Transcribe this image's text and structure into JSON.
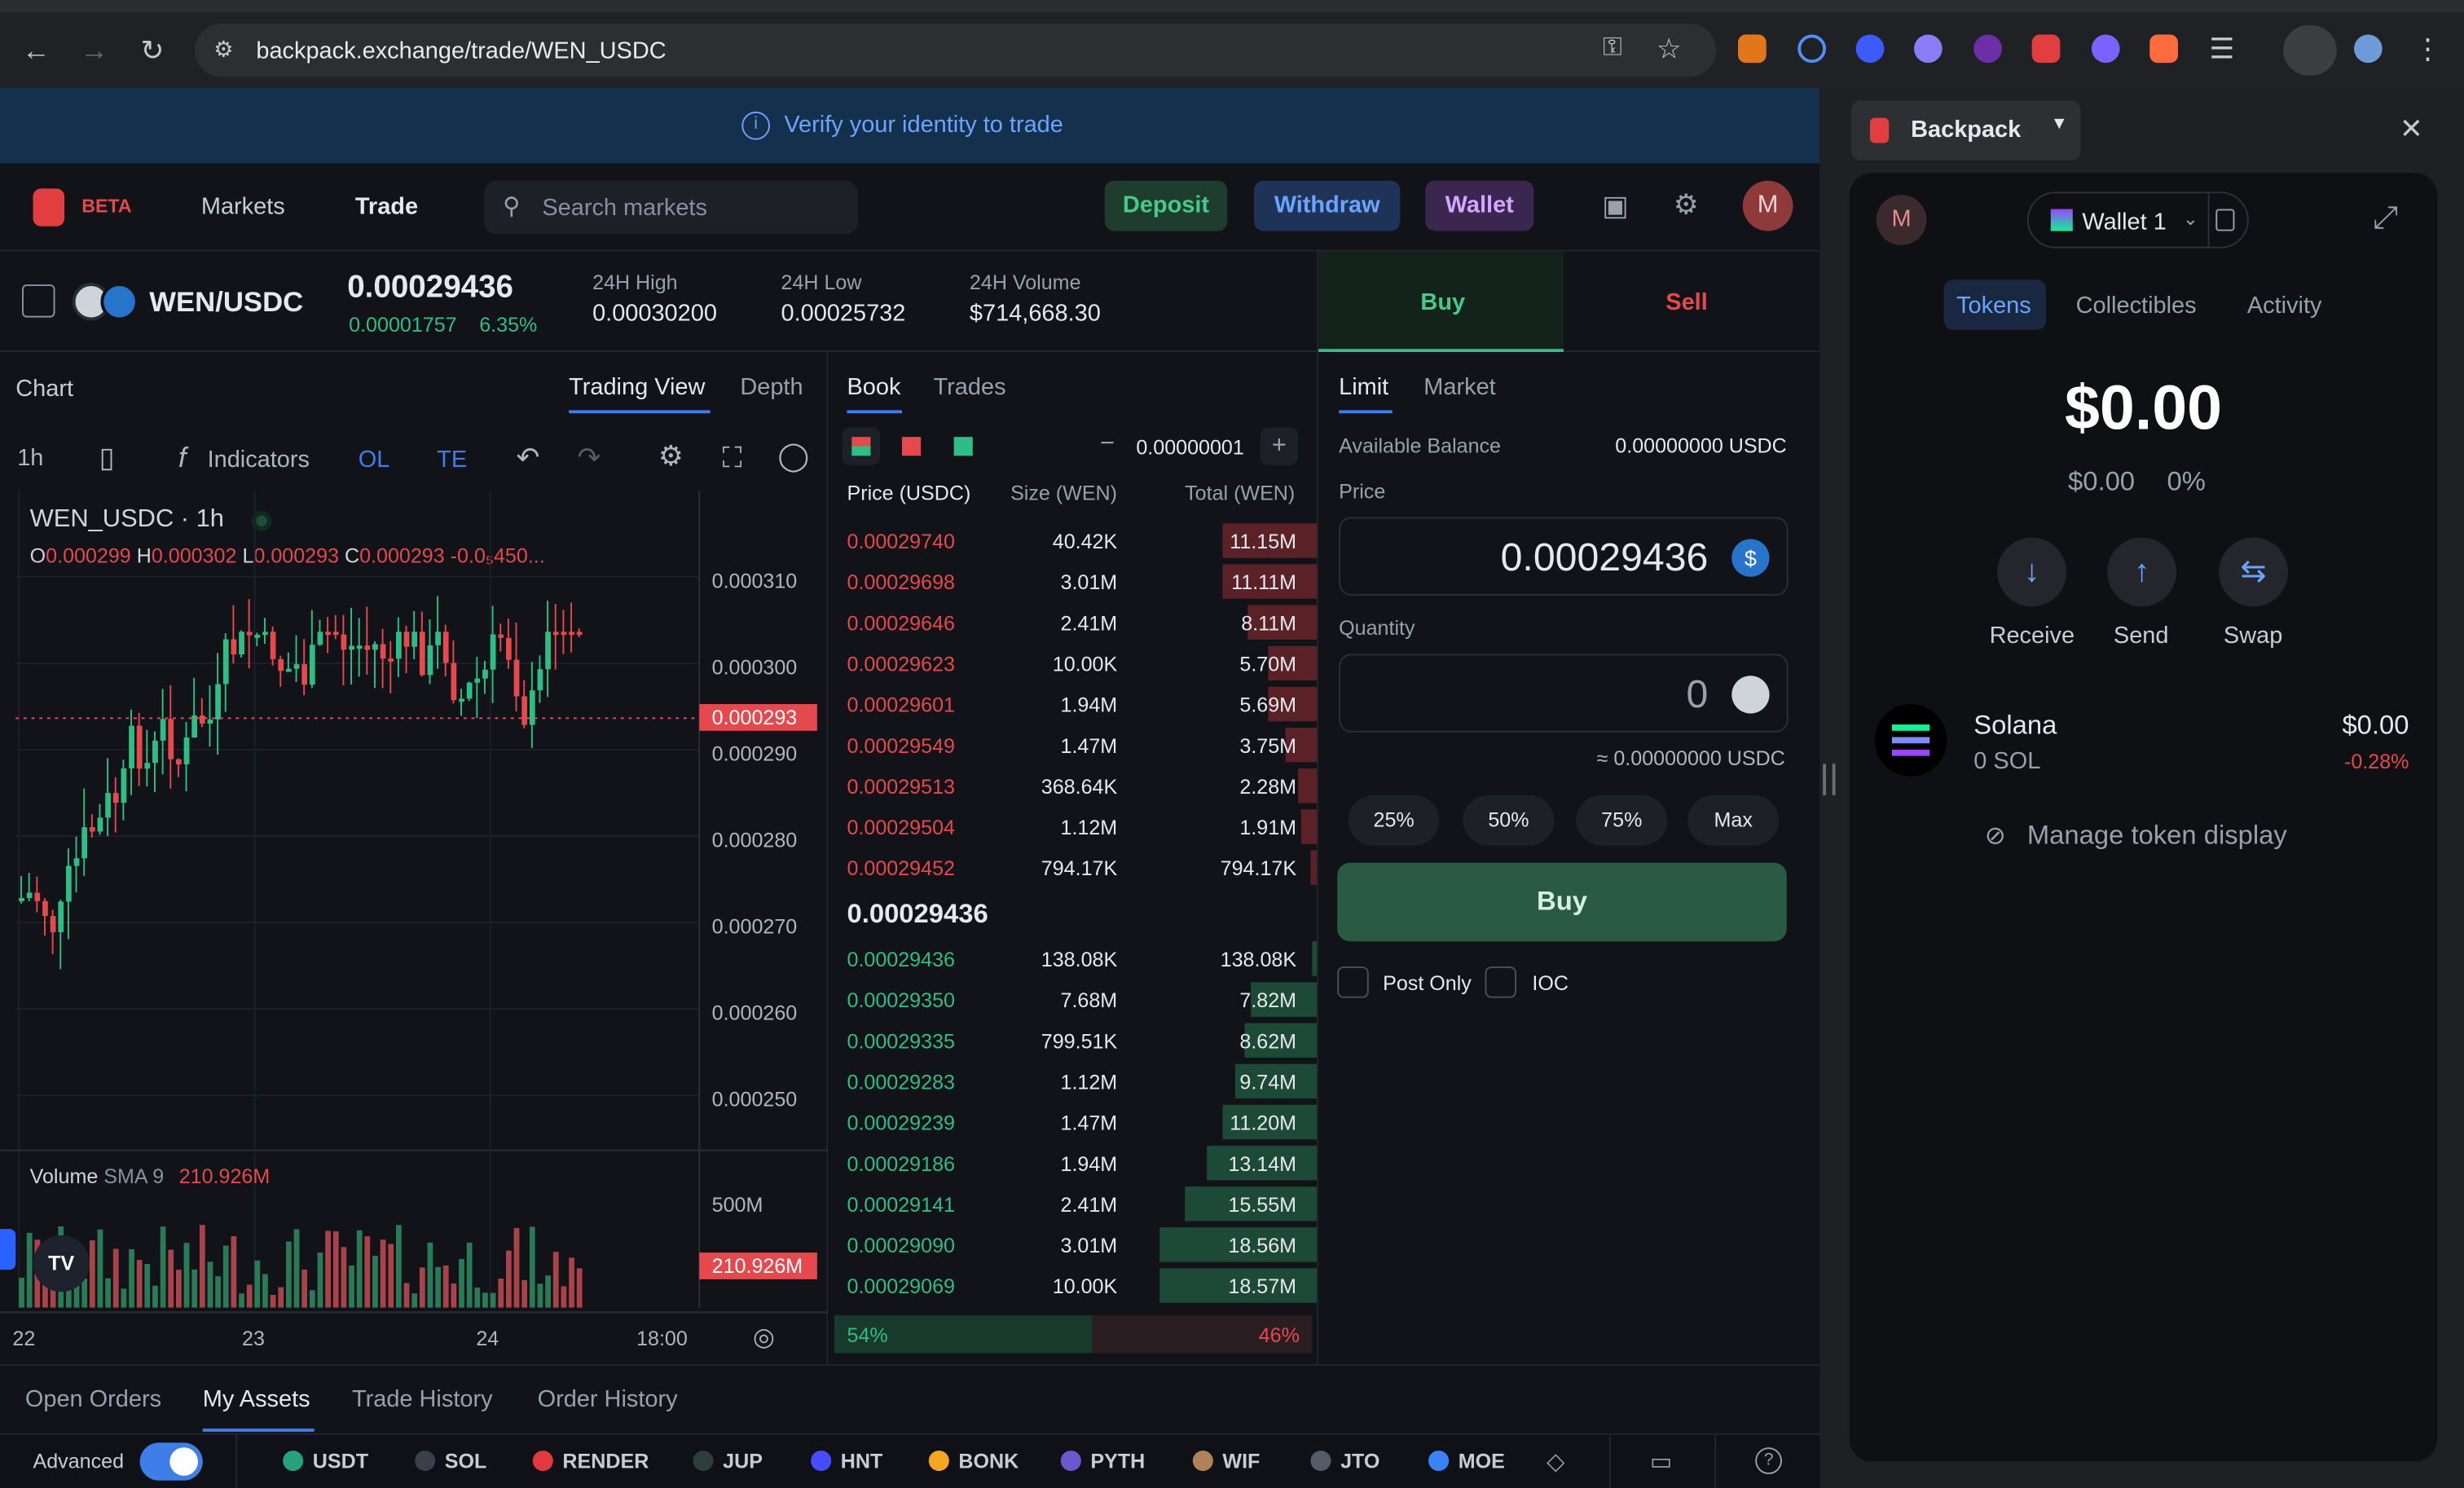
{
  "browser": {
    "url": "backpack.exchange/trade/WEN_USDC"
  },
  "banner": {
    "text": "Verify your identity to trade"
  },
  "header": {
    "beta": "BETA",
    "nav_markets": "Markets",
    "nav_trade": "Trade",
    "search_placeholder": "Search markets",
    "deposit": "Deposit",
    "withdraw": "Withdraw",
    "wallet": "Wallet",
    "avatar": "M"
  },
  "ticker": {
    "pair": "WEN/USDC",
    "price": "0.00029436",
    "change": "0.00001757",
    "change_pct": "6.35%",
    "high_label": "24H High",
    "high": "0.00030200",
    "low_label": "24H Low",
    "low": "0.00025732",
    "volume_label": "24H Volume",
    "volume": "$714,668.30"
  },
  "chart": {
    "title": "Chart",
    "tab_tradingview": "Trading View",
    "tab_depth": "Depth",
    "interval": "1h",
    "indicators": "Indicators",
    "ol": "OL",
    "te": "TE",
    "symbol": "WEN_USDC · 1h",
    "ohlc": {
      "o_label": "O",
      "o": "0.000299",
      "h_label": "H",
      "h": "0.000302",
      "l_label": "L",
      "l": "0.000293",
      "c_label": "C",
      "c": "0.000293",
      "chg": "-0.0₅450..."
    },
    "price_axis": [
      "0.000310",
      "0.000300",
      "0.000290",
      "0.000280",
      "0.000270",
      "0.000260",
      "0.000250"
    ],
    "last_price_tag": "0.000293",
    "volume_label": "Volume",
    "sma_label": "SMA 9",
    "sma_value": "210.926M",
    "vol_axis_500": "500M",
    "vol_tag": "210.926M",
    "time_axis": [
      "22",
      "23",
      "24",
      "18:00"
    ],
    "tv_logo": "TV"
  },
  "book": {
    "tab_book": "Book",
    "tab_trades": "Trades",
    "tick_size": "0.00000001",
    "col_price": "Price (USDC)",
    "col_size": "Size (WEN)",
    "col_total": "Total (WEN)",
    "asks": [
      {
        "price": "0.00029740",
        "size": "40.42K",
        "total": "11.15M",
        "depth": 0.6
      },
      {
        "price": "0.00029698",
        "size": "3.01M",
        "total": "11.11M",
        "depth": 0.6
      },
      {
        "price": "0.00029646",
        "size": "2.41M",
        "total": "8.11M",
        "depth": 0.44
      },
      {
        "price": "0.00029623",
        "size": "10.00K",
        "total": "5.70M",
        "depth": 0.31
      },
      {
        "price": "0.00029601",
        "size": "1.94M",
        "total": "5.69M",
        "depth": 0.31
      },
      {
        "price": "0.00029549",
        "size": "1.47M",
        "total": "3.75M",
        "depth": 0.2
      },
      {
        "price": "0.00029513",
        "size": "368.64K",
        "total": "2.28M",
        "depth": 0.12
      },
      {
        "price": "0.00029504",
        "size": "1.12M",
        "total": "1.91M",
        "depth": 0.1
      },
      {
        "price": "0.00029452",
        "size": "794.17K",
        "total": "794.17K",
        "depth": 0.04
      }
    ],
    "mid_price": "0.00029436",
    "bids": [
      {
        "price": "0.00029436",
        "size": "138.08K",
        "total": "138.08K",
        "depth": 0.03
      },
      {
        "price": "0.00029350",
        "size": "7.68M",
        "total": "7.82M",
        "depth": 0.42
      },
      {
        "price": "0.00029335",
        "size": "799.51K",
        "total": "8.62M",
        "depth": 0.46
      },
      {
        "price": "0.00029283",
        "size": "1.12M",
        "total": "9.74M",
        "depth": 0.52
      },
      {
        "price": "0.00029239",
        "size": "1.47M",
        "total": "11.20M",
        "depth": 0.6
      },
      {
        "price": "0.00029186",
        "size": "1.94M",
        "total": "13.14M",
        "depth": 0.7
      },
      {
        "price": "0.00029141",
        "size": "2.41M",
        "total": "15.55M",
        "depth": 0.84
      },
      {
        "price": "0.00029090",
        "size": "3.01M",
        "total": "18.56M",
        "depth": 1.0
      },
      {
        "price": "0.00029069",
        "size": "10.00K",
        "total": "18.57M",
        "depth": 1.0
      }
    ],
    "buy_pct": "54%",
    "sell_pct": "46%",
    "buy_ratio": 0.54
  },
  "order": {
    "buy": "Buy",
    "sell": "Sell",
    "limit": "Limit",
    "market": "Market",
    "avail_label": "Available Balance",
    "avail": "0.00000000 USDC",
    "price_label": "Price",
    "price": "0.00029436",
    "qty_label": "Quantity",
    "qty": "0",
    "approx": "≈ 0.00000000 USDC",
    "p25": "25%",
    "p50": "50%",
    "p75": "75%",
    "max": "Max",
    "submit": "Buy",
    "post_only": "Post Only",
    "ioc": "IOC"
  },
  "bottom": {
    "tabs": [
      "Open Orders",
      "My Assets",
      "Trade History",
      "Order History"
    ],
    "advanced": "Advanced",
    "tokens": [
      {
        "sym": "USDT",
        "color": "#26a17b"
      },
      {
        "sym": "SOL",
        "color": "#3a3f4a"
      },
      {
        "sym": "RENDER",
        "color": "#e2383f"
      },
      {
        "sym": "JUP",
        "color": "#2c3e3a"
      },
      {
        "sym": "HNT",
        "color": "#474dff"
      },
      {
        "sym": "BONK",
        "color": "#f5a623"
      },
      {
        "sym": "PYTH",
        "color": "#6e56cf"
      },
      {
        "sym": "WIF",
        "color": "#b0825a"
      },
      {
        "sym": "JTO",
        "color": "#555b66"
      },
      {
        "sym": "MOE",
        "color": "#3b82f6"
      }
    ]
  },
  "wallet": {
    "title": "Backpack",
    "avatar": "M",
    "wallet_name": "Wallet 1",
    "tab_tokens": "Tokens",
    "tab_collectibles": "Collectibles",
    "tab_activity": "Activity",
    "balance": "$0.00",
    "balance_change": "$0.00",
    "balance_pct": "0%",
    "receive": "Receive",
    "send": "Send",
    "swap": "Swap",
    "token_name": "Solana",
    "token_amount": "0 SOL",
    "token_value": "$0.00",
    "token_change": "-0.28%",
    "manage": "Manage token display"
  },
  "colors": {
    "green": "#2ebd85",
    "red": "#e5484d",
    "accent": "#3f7ee8"
  }
}
